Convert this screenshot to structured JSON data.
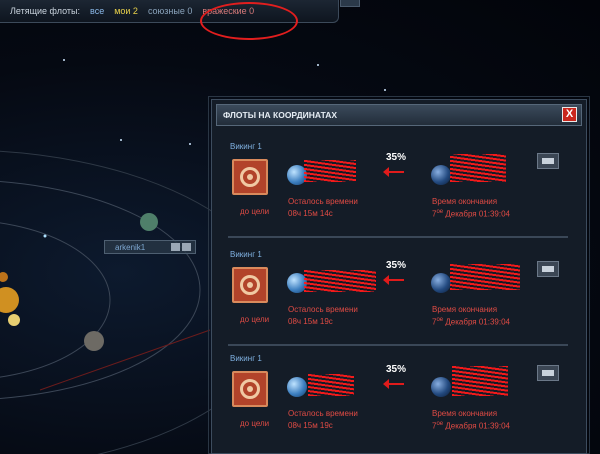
{
  "topbar": {
    "label": "Летящие флоты:",
    "filters": {
      "all": "все",
      "mine": "мои 2",
      "allied": "союзные 0",
      "enemy": "вражеские 0"
    }
  },
  "planet_label": "arkenik1",
  "panel": {
    "title": "ФЛОТЫ НА КООРДИНАТАХ",
    "close": "X"
  },
  "fleets": [
    {
      "name": "Викинг 1",
      "to_target": "до цели",
      "progress": "35%",
      "remaining_label": "Осталось времени",
      "remaining_value": "08ч 15м 14с",
      "end_label": "Время окончания",
      "end_day": "7",
      "end_sup": "ое",
      "end_rest": " Декабря 01:39:04"
    },
    {
      "name": "Викинг 1",
      "to_target": "до цели",
      "progress": "35%",
      "remaining_label": "Осталось времени",
      "remaining_value": "08ч 15м 19с",
      "end_label": "Время окончания",
      "end_day": "7",
      "end_sup": "ое",
      "end_rest": " Декабря 01:39:04"
    },
    {
      "name": "Викинг 1",
      "to_target": "до цели",
      "progress": "35%",
      "remaining_label": "Осталось времени",
      "remaining_value": "08ч 15м 19с",
      "end_label": "Время окончания",
      "end_day": "7",
      "end_sup": "ое",
      "end_rest": " Декабря 01:39:04"
    }
  ],
  "colors": {
    "accent_red": "#e04b44",
    "label_blue": "#7fb0e0",
    "panel_bg": "#141c27"
  }
}
